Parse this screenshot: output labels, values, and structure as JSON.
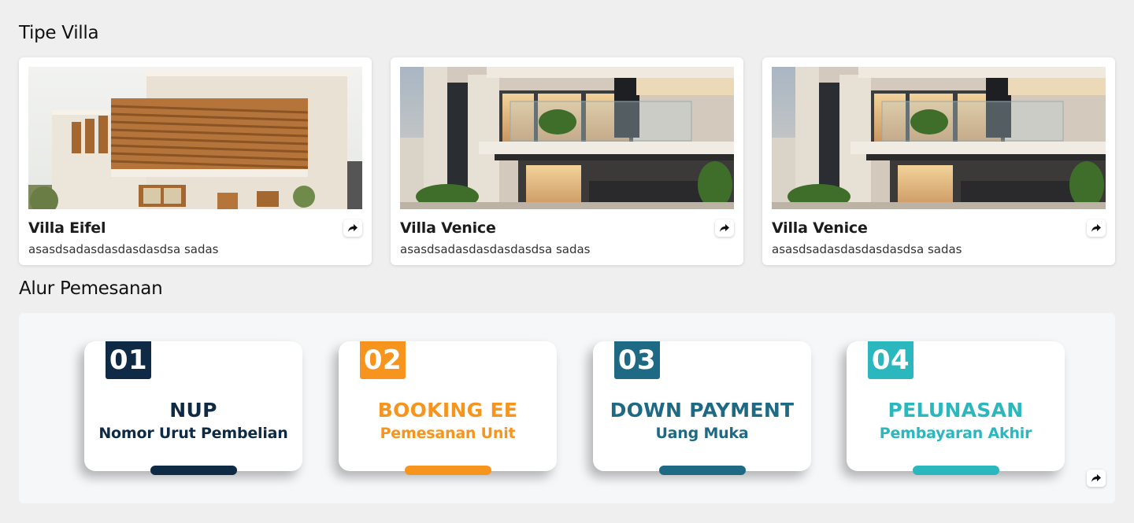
{
  "villa_section": {
    "title": "Tipe Villa",
    "villas": [
      {
        "name": "Villa Eifel",
        "description": "asasdsadasdasdasdasdsa sadas"
      },
      {
        "name": "Villa Venice",
        "description": "asasdsadasdasdasdasdsa sadas"
      },
      {
        "name": "Villa Venice",
        "description": "asasdsadasdasdasdasdsa sadas"
      }
    ]
  },
  "alur_section": {
    "title": "Alur Pemesanan",
    "steps": [
      {
        "number": "01",
        "title": "NUP",
        "subtitle": "Nomor Urut Pembelian",
        "color": "#0f2a44"
      },
      {
        "number": "02",
        "title": "BOOKING EE",
        "subtitle": "Pemesanan Unit",
        "color": "#f7941d"
      },
      {
        "number": "03",
        "title": "DOWN PAYMENT",
        "subtitle": "Uang Muka",
        "color": "#1e6a85"
      },
      {
        "number": "04",
        "title": "PELUNASAN",
        "subtitle": "Pembayaran Akhir",
        "color": "#2ab7bd"
      }
    ]
  },
  "icons": {
    "share": "share-arrow-icon"
  }
}
